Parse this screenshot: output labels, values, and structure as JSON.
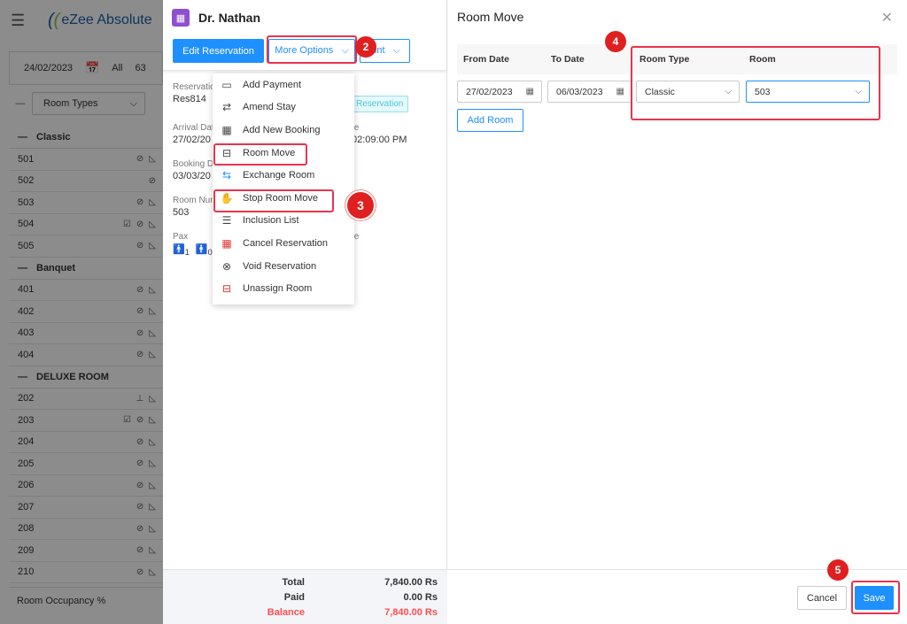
{
  "app": {
    "brand": "eZee Absolute",
    "date": "24/02/2023",
    "all_label": "All",
    "all_count": "63",
    "room_types_filter": "Room Types",
    "footer_label": "Room Occupancy %",
    "groups": [
      {
        "name": "Classic",
        "rooms": [
          "501",
          "502",
          "503",
          "504",
          "505"
        ]
      },
      {
        "name": "Banquet",
        "rooms": [
          "401",
          "402",
          "403",
          "404"
        ]
      },
      {
        "name": "DELUXE ROOM",
        "rooms": [
          "202",
          "203",
          "204",
          "205",
          "206",
          "207",
          "208",
          "209",
          "210"
        ]
      }
    ]
  },
  "reservation": {
    "guest_name": "Dr. Nathan",
    "edit_button": "Edit Reservation",
    "more_options_button": "More Options",
    "print_button": "Print",
    "reservation_label": "Reservation",
    "reservation_no": "Res814",
    "badge": "Reservation",
    "arrival_label": "Arrival Dat",
    "arrival_value": "27/02/20",
    "departure_label": "te",
    "departure_time": "02:09:00 PM",
    "booking_label": "Booking D",
    "booking_value": "03/03/20",
    "room_number_label": "Room Num",
    "room_number_value": "503",
    "pax_label": "Pax",
    "pax_adults": "1",
    "pax_children": "0",
    "pax_right_label": "te",
    "totals": {
      "total_label": "Total",
      "total_value": "7,840.00 Rs",
      "paid_label": "Paid",
      "paid_value": "0.00 Rs",
      "balance_label": "Balance",
      "balance_value": "7,840.00 Rs"
    }
  },
  "menu": {
    "items": [
      {
        "label": "Add Payment",
        "icon": "payment-icon"
      },
      {
        "label": "Amend Stay",
        "icon": "amend-icon"
      },
      {
        "label": "Add New Booking",
        "icon": "calendar-icon"
      },
      {
        "label": "Room Move",
        "icon": "bed-move-icon"
      },
      {
        "label": "Exchange Room",
        "icon": "exchange-icon"
      },
      {
        "label": "Stop Room Move",
        "icon": "hand-stop-icon"
      },
      {
        "label": "Inclusion List",
        "icon": "list-icon"
      },
      {
        "label": "Cancel Reservation",
        "icon": "cancel-calendar-icon"
      },
      {
        "label": "Void Reservation",
        "icon": "void-icon"
      },
      {
        "label": "Unassign Room",
        "icon": "unassign-icon"
      }
    ]
  },
  "room_move": {
    "title": "Room Move",
    "headers": {
      "from_date": "From Date",
      "to_date": "To Date",
      "room_type": "Room Type",
      "room": "Room"
    },
    "from_date": "27/02/2023",
    "to_date": "06/03/2023",
    "room_type": "Classic",
    "room": "503",
    "add_room_button": "Add Room",
    "cancel_button": "Cancel",
    "save_button": "Save"
  },
  "steps": [
    "2",
    "3",
    "4",
    "5"
  ],
  "colors": {
    "accent": "#1e90ff",
    "highlight": "#e8344e",
    "step_badge": "#e02020",
    "balance": "#ff4d4f"
  }
}
